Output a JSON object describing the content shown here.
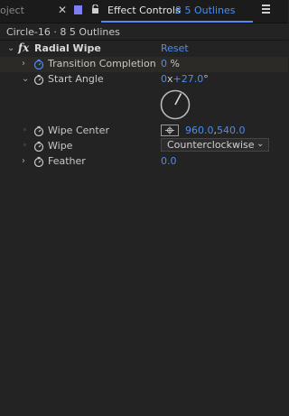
{
  "tabbar": {
    "project_tab": "oject",
    "panel_title": "Effect Controls",
    "layer_name": "8 5 Outlines",
    "swatch_color": "#7f7ff4",
    "accent_color": "#4d8df0",
    "close_icon": "close-icon",
    "lock_icon": "lock-icon",
    "menu_icon": "hamburger-menu-icon"
  },
  "layer_path": "Circle-16 · 8 5 Outlines",
  "effect": {
    "name": "Radial Wipe",
    "reset_label": "Reset",
    "properties": {
      "transition_completion": {
        "label": "Transition Completion",
        "value": "0",
        "unit": "%"
      },
      "start_angle": {
        "label": "Start Angle",
        "revolutions": "0",
        "x": "x",
        "degrees": "+27.0",
        "unit": "°"
      },
      "wipe_center": {
        "label": "Wipe Center",
        "x": "960.0",
        "y": "540.0",
        "separator": ","
      },
      "wipe": {
        "label": "Wipe",
        "selected": "Counterclockwise"
      },
      "feather": {
        "label": "Feather",
        "value": "0.0"
      }
    }
  }
}
